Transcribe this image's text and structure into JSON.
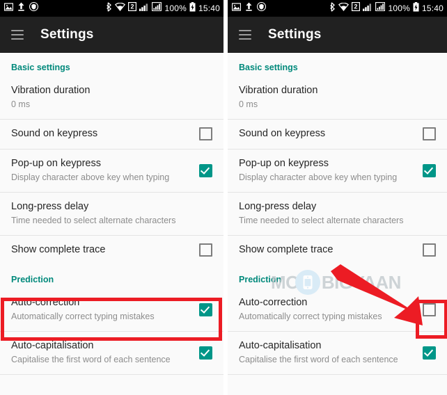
{
  "status_bar": {
    "icons_left": [
      "image-icon",
      "upload-icon",
      "shield-icon"
    ],
    "icons_right": [
      "bluetooth-icon",
      "wifi-icon",
      "dual-sim-icon",
      "signal-sim1-icon",
      "signal-sim2-icon"
    ],
    "sim_label": "2",
    "battery_percent": "100%",
    "battery_icon": "battery-charging-icon",
    "time": "15:40"
  },
  "toolbar": {
    "menu_icon": "hamburger-menu-icon",
    "title": "Settings"
  },
  "sections": [
    {
      "label": "Basic settings"
    },
    {
      "label": "Prediction"
    }
  ],
  "rows": {
    "vibration": {
      "title": "Vibration duration",
      "subtitle": "0 ms"
    },
    "sound_on_keypress": {
      "title": "Sound on keypress",
      "subtitle": "",
      "checked_left": false,
      "checked_right": false
    },
    "popup_on_keypress": {
      "title": "Pop-up on keypress",
      "subtitle": "Display character above key when typing",
      "checked_left": true,
      "checked_right": true
    },
    "long_press_delay": {
      "title": "Long-press delay",
      "subtitle": "Time needed to select alternate characters"
    },
    "show_complete_trace": {
      "title": "Show complete trace",
      "subtitle": "",
      "checked_left": false,
      "checked_right": false
    },
    "auto_correction": {
      "title": "Auto-correction",
      "subtitle": "Automatically correct typing mistakes",
      "checked_left": true,
      "checked_right": false
    },
    "auto_capitalisation": {
      "title": "Auto-capitalisation",
      "subtitle": "Capitalise the first word of each sentence",
      "checked_left": true,
      "checked_right": true
    }
  },
  "watermark": {
    "text_mo": "MO",
    "text_rest": "BIGYAAN",
    "logo_icon": "phone-logo-icon"
  },
  "annotations": {
    "arrow_icon": "red-arrow-icon",
    "highlight_color": "#ec1c24"
  },
  "colors": {
    "accent_teal": "#009688",
    "section_header": "#00897b",
    "toolbar_bg": "#212121",
    "status_bg": "#000000",
    "list_bg": "#fafafa"
  }
}
